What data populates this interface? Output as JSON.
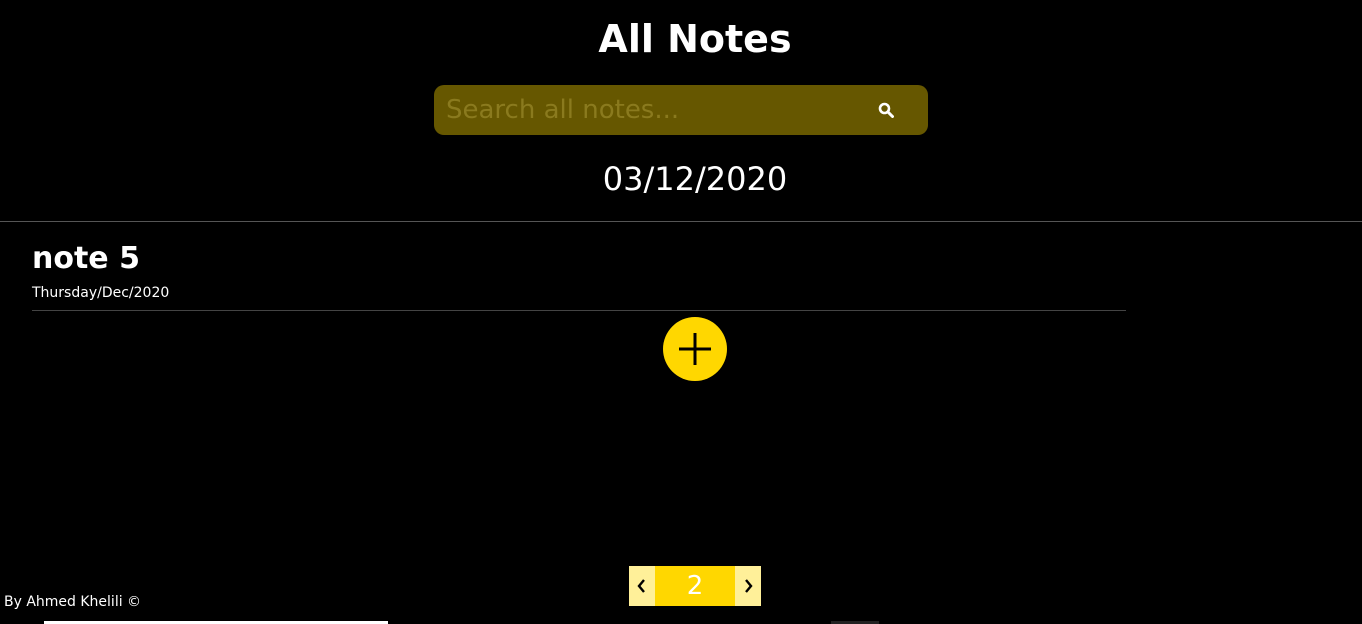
{
  "header": {
    "title": "All Notes"
  },
  "search": {
    "placeholder": "Search all notes...",
    "value": ""
  },
  "current_date": "03/12/2020",
  "notes": [
    {
      "title": "note 5",
      "date": "Thursday/Dec/2020"
    }
  ],
  "add_button": {
    "icon": "plus-icon"
  },
  "pagination": {
    "current_page": "2",
    "prev_icon": "chevron-left-icon",
    "next_icon": "chevron-right-icon"
  },
  "footer": {
    "credit": "By Ahmed Khelili ©"
  },
  "colors": {
    "background": "#000000",
    "accent": "#ffd700",
    "search_bg": "#665700",
    "text": "#ffffff"
  }
}
